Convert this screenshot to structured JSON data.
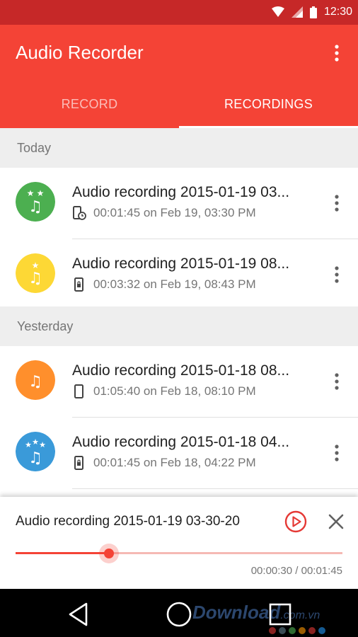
{
  "status_bar": {
    "time": "12:30"
  },
  "app_bar": {
    "title": "Audio Recorder"
  },
  "tabs": [
    {
      "label": "RECORD",
      "active": false
    },
    {
      "label": "RECORDINGS",
      "active": true
    }
  ],
  "sections": [
    {
      "header": "Today",
      "items": [
        {
          "title": "Audio recording 2015-01-19 03...",
          "detail": "00:01:45 on Feb 19, 03:30 PM",
          "avatar_color": "#4caf50",
          "avatar_icon": "two-stars-music-note-icon",
          "source_icon": "phone-clock-icon"
        },
        {
          "title": "Audio recording 2015-01-19 08...",
          "detail": "00:03:32 on Feb 19, 08:43 PM",
          "avatar_color": "#fdd835",
          "avatar_icon": "one-star-music-note-icon",
          "source_icon": "phone-lock-icon"
        }
      ]
    },
    {
      "header": "Yesterday",
      "items": [
        {
          "title": "Audio recording 2015-01-18 08...",
          "detail": "01:05:40 on Feb 18, 08:10 PM",
          "avatar_color": "#ff8f2c",
          "avatar_icon": "music-note-icon",
          "source_icon": "phone-icon"
        },
        {
          "title": "Audio recording 2015-01-18 04...",
          "detail": "00:01:45 on Feb 18, 04:22 PM",
          "avatar_color": "#3a9ad9",
          "avatar_icon": "three-stars-music-note-icon",
          "source_icon": "phone-lock-icon"
        }
      ]
    }
  ],
  "player": {
    "title": "Audio recording 2015-01-19 03-30-20",
    "time": "00:00:30 / 00:01:45",
    "progress": 0.286
  },
  "watermark": {
    "text": "Download",
    "suffix": ".com.vn"
  },
  "colors": {
    "primary": "#f44336",
    "primary_dark": "#c62828",
    "accent_track": "#f5b9b4"
  }
}
